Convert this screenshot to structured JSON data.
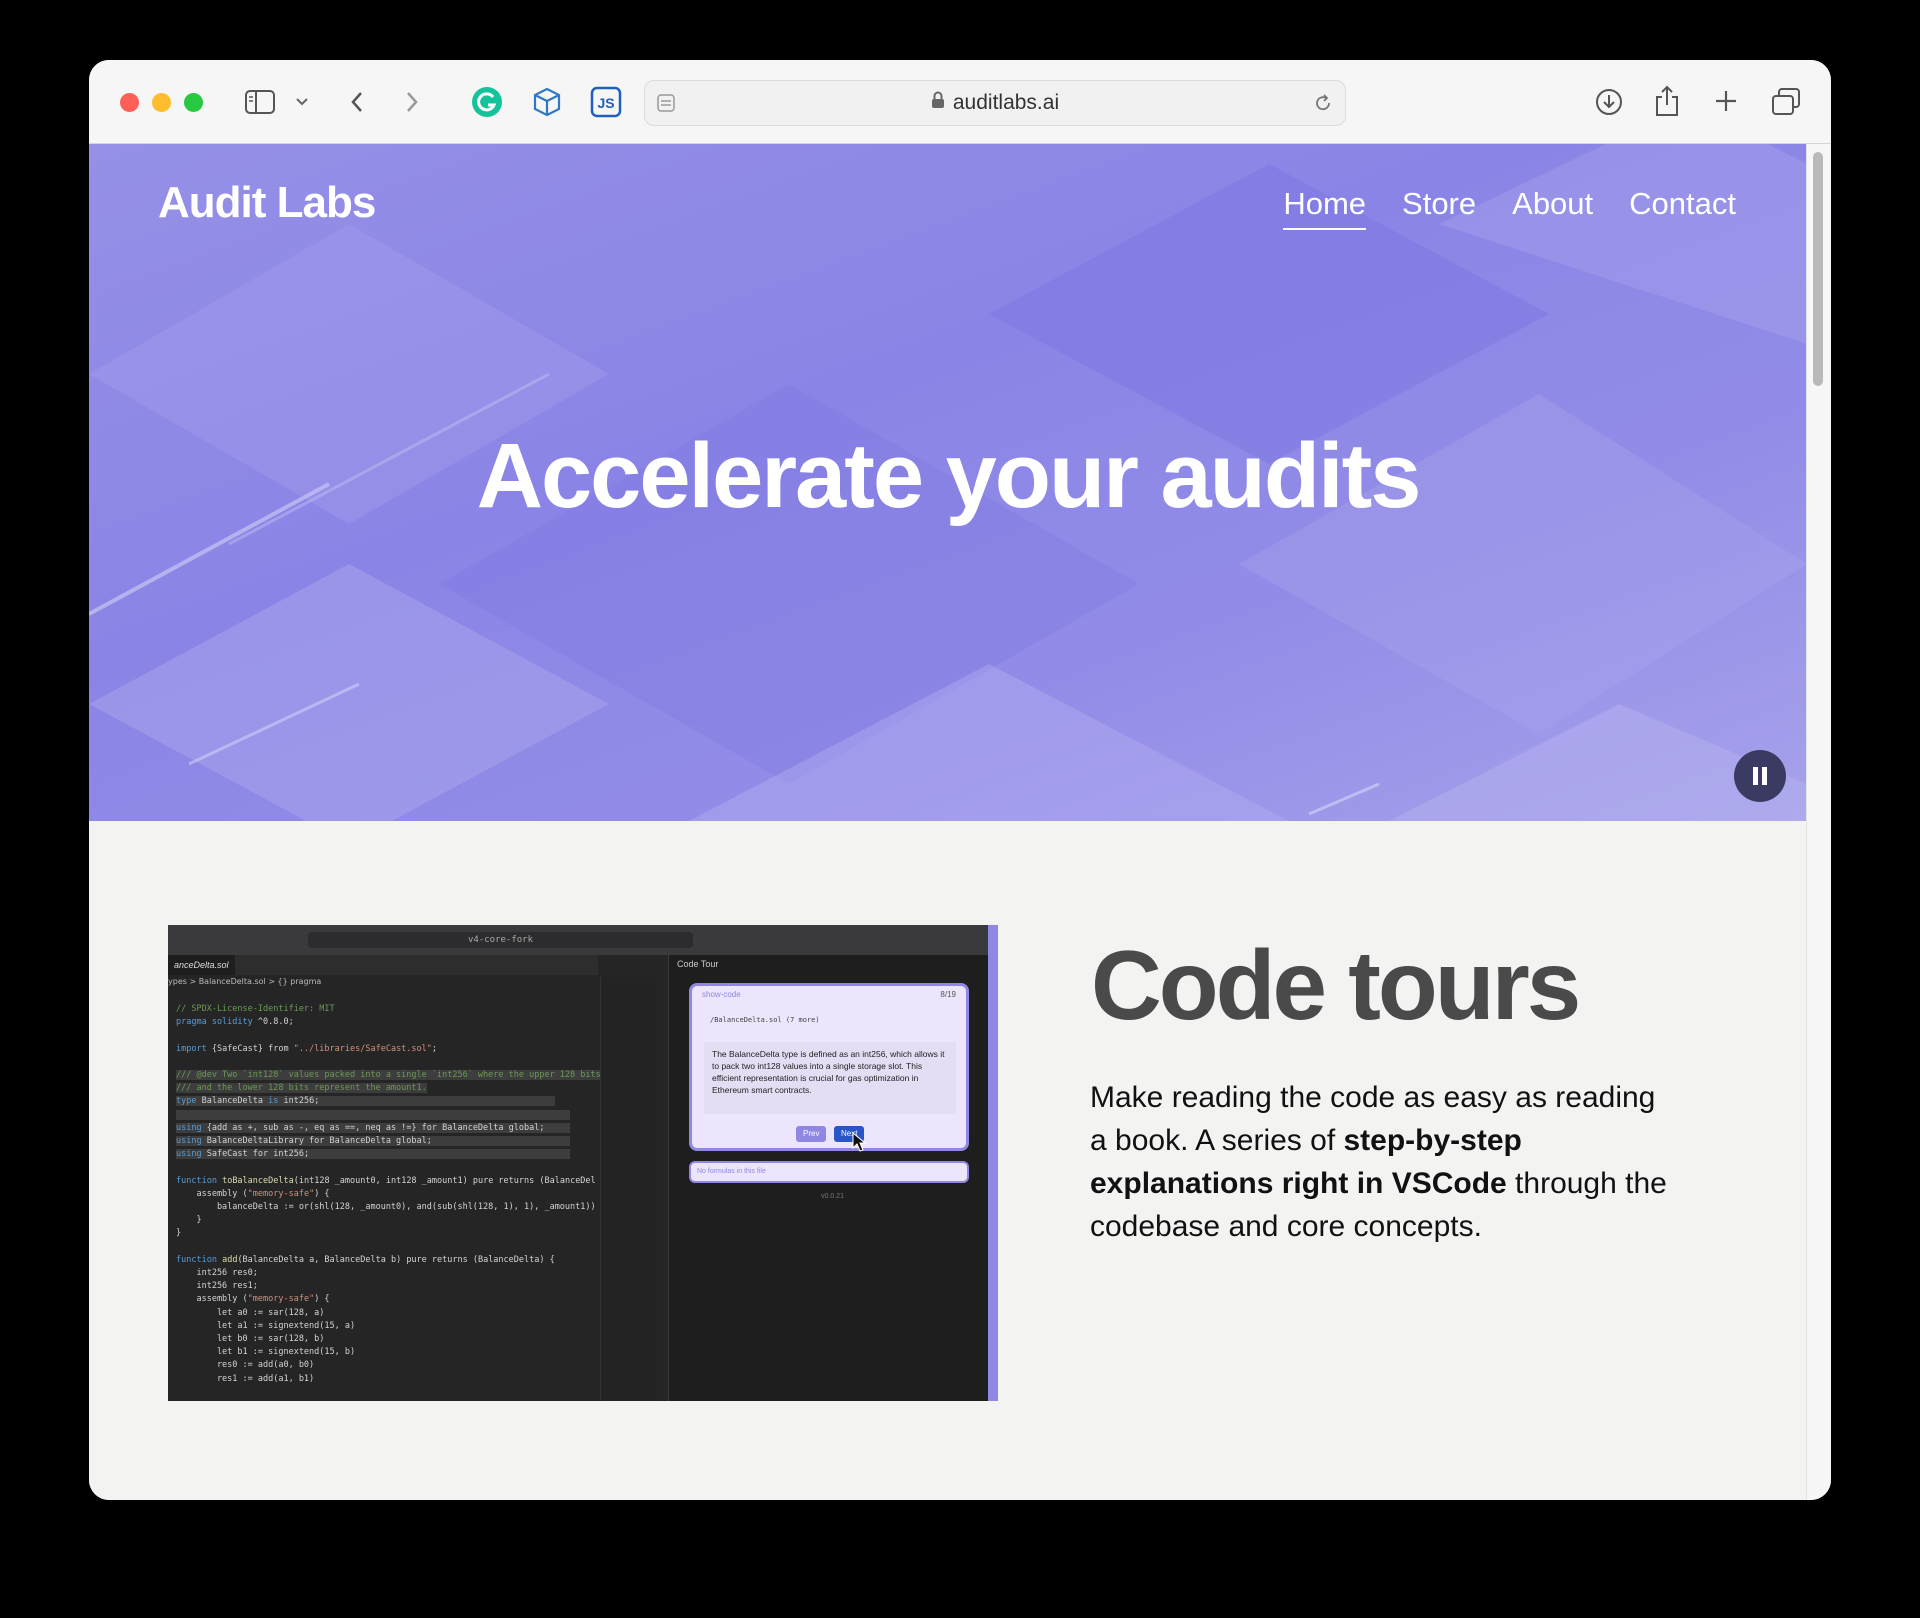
{
  "browser": {
    "url": "auditlabs.ai"
  },
  "site": {
    "brand": "Audit Labs",
    "nav": [
      {
        "label": "Home"
      },
      {
        "label": "Store"
      },
      {
        "label": "About"
      },
      {
        "label": "Contact"
      }
    ],
    "hero_title": "Accelerate your audits"
  },
  "feature": {
    "title": "Code tours",
    "text_1": "Make reading the code as easy as reading a book. A series of ",
    "text_bold": "step-by-step explanations right in VSCode",
    "text_2": " through the codebase and core concepts."
  },
  "screenshot": {
    "search": "v4-core-fork",
    "file_tab": "anceDelta.sol",
    "crumb": "ypes > BalanceDelta.sol > {} pragma",
    "panel_tab": "Code Tour",
    "tour_header": "show-code",
    "tour_count": "8/19",
    "tour_file": "/BalanceDelta.sol (7 more)",
    "tour_text": "The BalanceDelta type is defined as an int256, which allows it to pack two int128 values into a single storage slot. This efficient representation is crucial for gas optimization in Ethereum smart contracts.",
    "prev": "Prev",
    "next": "Next",
    "input_placeholder": "No formulas in this file",
    "version": "v0.0.21"
  }
}
